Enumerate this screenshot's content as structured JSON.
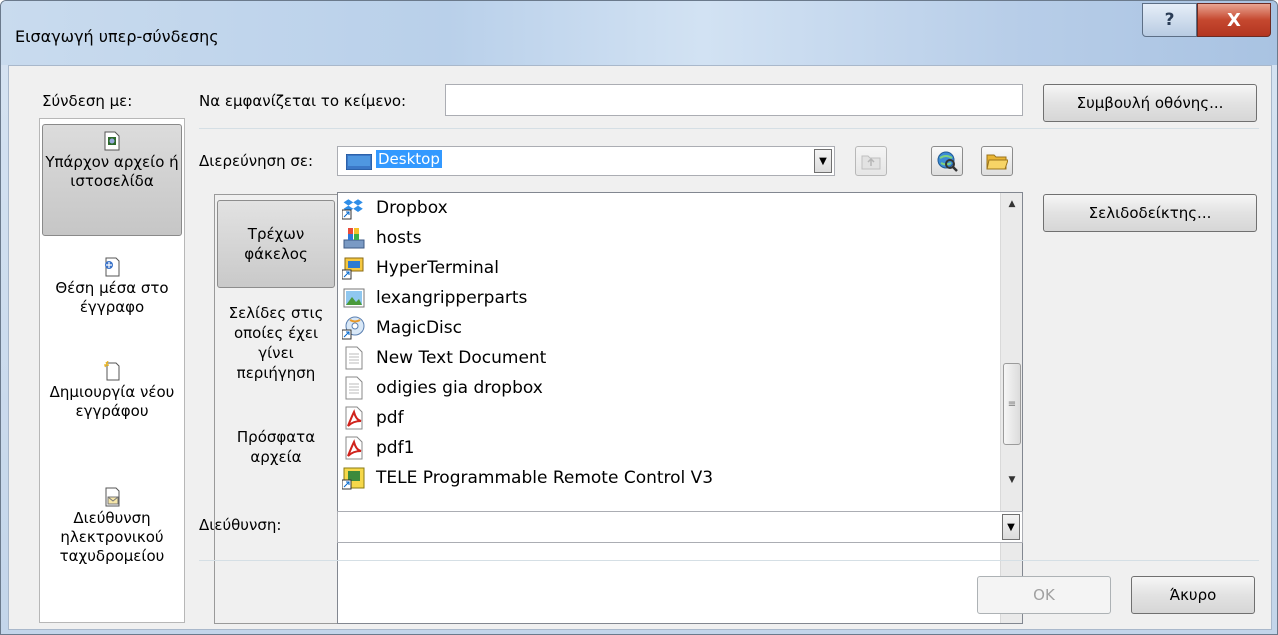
{
  "window": {
    "title": "Εισαγωγή υπερ-σύνδεσης",
    "help_glyph": "?",
    "close_glyph": "X"
  },
  "link_to": {
    "label": "Σύνδεση με:",
    "items": [
      {
        "label": "Υπάρχον αρχείο ή ιστοσελίδα",
        "icon": "existing-file-icon",
        "selected": true
      },
      {
        "label": "Θέση μέσα στο έγγραφο",
        "icon": "place-in-document-icon",
        "selected": false
      },
      {
        "label": "Δημιουργία νέου εγγράφου",
        "icon": "new-document-icon",
        "selected": false
      },
      {
        "label": "Διεύθυνση ηλεκτρονικού ταχυδρομείου",
        "icon": "email-address-icon",
        "selected": false
      }
    ]
  },
  "text_to_display": {
    "label": "Να εμφανίζεται το κείμενο:",
    "value": ""
  },
  "screentip_button": "Συμβουλή οθόνης...",
  "look_in": {
    "label": "Διερεύνηση σε:",
    "value": "Desktop"
  },
  "bookmark_button": "Σελιδοδείκτης...",
  "side_nav": [
    {
      "label": "Τρέχων φάκελος",
      "selected": true
    },
    {
      "label": "Σελίδες στις οποίες έχει γίνει περιήγηση",
      "selected": false
    },
    {
      "label": "Πρόσφατα αρχεία",
      "selected": false
    }
  ],
  "files": [
    {
      "name": "Dropbox",
      "icon": "dropbox-shortcut-icon"
    },
    {
      "name": "hosts",
      "icon": "system-file-icon"
    },
    {
      "name": "HyperTerminal",
      "icon": "hyperterminal-shortcut-icon"
    },
    {
      "name": "lexangripperparts",
      "icon": "image-file-icon"
    },
    {
      "name": "MagicDisc",
      "icon": "magicdisc-shortcut-icon"
    },
    {
      "name": "New Text Document",
      "icon": "text-document-icon"
    },
    {
      "name": "odigies gia dropbox",
      "icon": "text-document-icon"
    },
    {
      "name": "pdf",
      "icon": "pdf-file-icon"
    },
    {
      "name": "pdf1",
      "icon": "pdf-file-icon"
    },
    {
      "name": "TELE Programmable Remote Control V3",
      "icon": "remote-control-shortcut-icon"
    }
  ],
  "address": {
    "label": "Διεύθυνση:",
    "value": ""
  },
  "ok_button": "OK",
  "cancel_button": "Άκυρο"
}
